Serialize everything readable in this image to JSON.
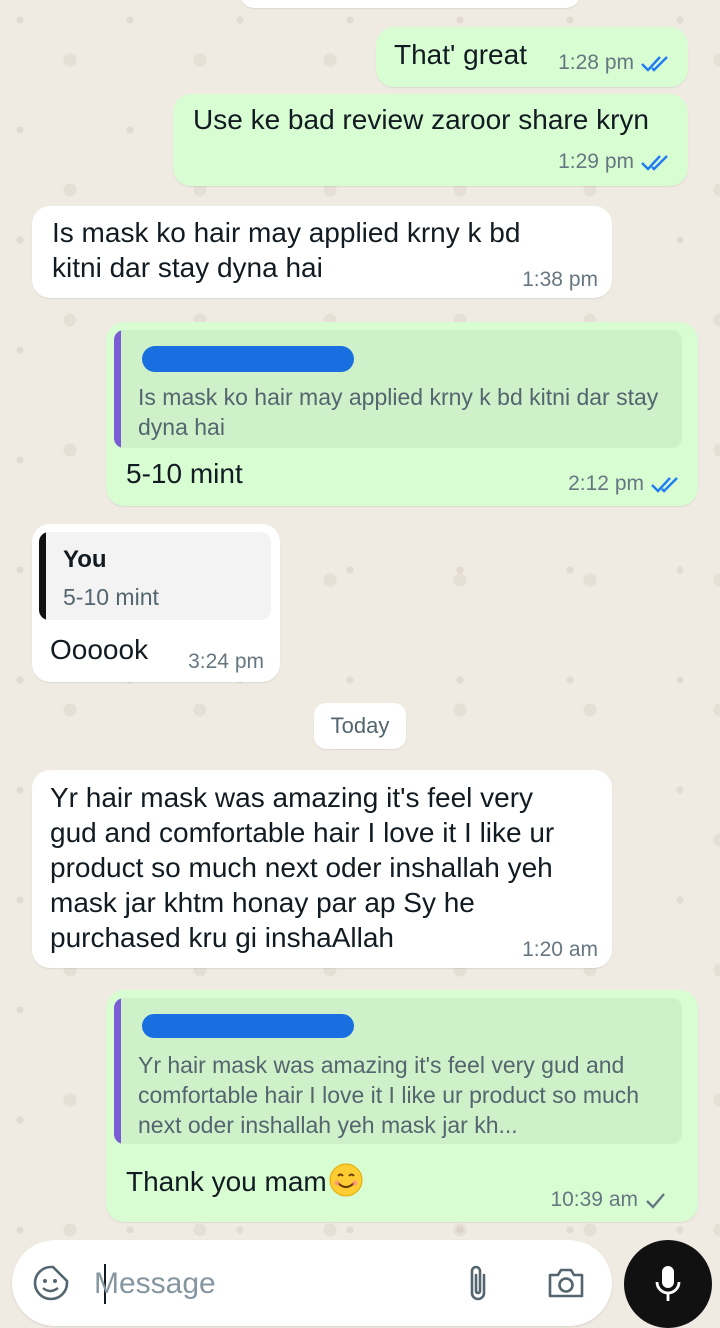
{
  "messages": [
    {
      "id": "m1",
      "direction": "out",
      "text": "That' great",
      "time": "1:28 pm",
      "status": "read"
    },
    {
      "id": "m2",
      "direction": "out",
      "text": "Use ke bad review zaroor share kryn",
      "time": "1:29 pm",
      "status": "read"
    },
    {
      "id": "m3",
      "direction": "in",
      "text": "Is mask ko hair may applied krny k bd kitni dar stay dyna hai",
      "time": "1:38 pm"
    },
    {
      "id": "m4",
      "direction": "out",
      "quote": {
        "text": "Is mask ko hair may applied krny k bd kitni dar stay dyna hai"
      },
      "text": "5-10 mint",
      "time": "2:12 pm",
      "status": "read"
    },
    {
      "id": "m5",
      "direction": "in",
      "quote": {
        "author": "You",
        "text": "5-10 mint"
      },
      "text": "Oooook",
      "time": "3:24 pm"
    },
    {
      "id": "m6",
      "direction": "in",
      "text": "Yr hair mask was amazing it's feel very gud and comfortable hair I love it I like ur product so much next oder inshallah yeh mask jar khtm honay par ap Sy he purchased kru gi inshaAllah",
      "time": "1:20 am"
    },
    {
      "id": "m7",
      "direction": "out",
      "quote": {
        "text": "Yr hair mask was amazing it's feel very gud and comfortable hair I love it I like ur product so much next oder inshallah yeh mask jar kh..."
      },
      "text": "Thank you mam",
      "emoji": "smiling-face-emoji",
      "time": "10:39 am",
      "status": "sent"
    }
  ],
  "date_separator": "Today",
  "composer": {
    "placeholder": "Message",
    "value": ""
  },
  "icons": {
    "sticker": "sticker-icon",
    "attach": "paperclip-icon",
    "camera": "camera-icon",
    "mic": "mic-icon",
    "read_receipt": "double-check-icon",
    "sent_receipt": "single-check-icon"
  },
  "colors": {
    "outgoing_bubble": "#d9fdd3",
    "incoming_bubble": "#ffffff",
    "wallpaper": "#efeae2",
    "read_tick": "#1f7cf1",
    "outgoing_quote_bar": "#7a5cd6",
    "incoming_quote_bar": "#111111",
    "mic_button": "#111111"
  }
}
